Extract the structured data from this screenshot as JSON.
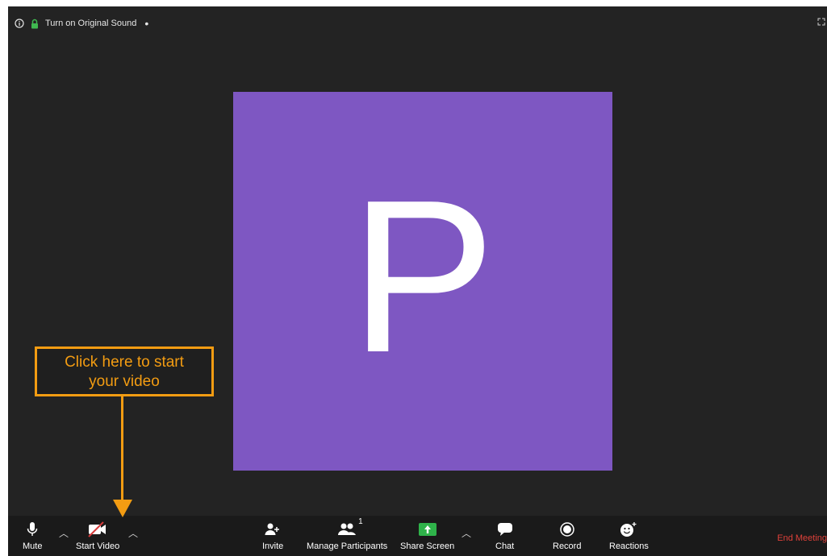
{
  "topbar": {
    "original_sound_label": "Turn on Original Sound",
    "separator": "•",
    "info_icon": "info-icon",
    "lock_icon": "lock-icon",
    "lock_color": "#3fb950",
    "fullscreen_icon": "fullscreen-icon"
  },
  "stage": {
    "letter": "P",
    "tile_color": "#7e57c2"
  },
  "callout": {
    "line1": "Click here to start",
    "line2": "your video",
    "color": "#f39c12"
  },
  "toolbar": {
    "mute_label": "Mute",
    "start_video_label": "Start Video",
    "invite_label": "Invite",
    "manage_participants_label": "Manage Participants",
    "participant_count": "1",
    "share_screen_label": "Share Screen",
    "share_color": "#2fb34a",
    "chat_label": "Chat",
    "record_label": "Record",
    "reactions_label": "Reactions",
    "end_meeting_label": "End Meeting",
    "end_color": "#e0413a"
  }
}
